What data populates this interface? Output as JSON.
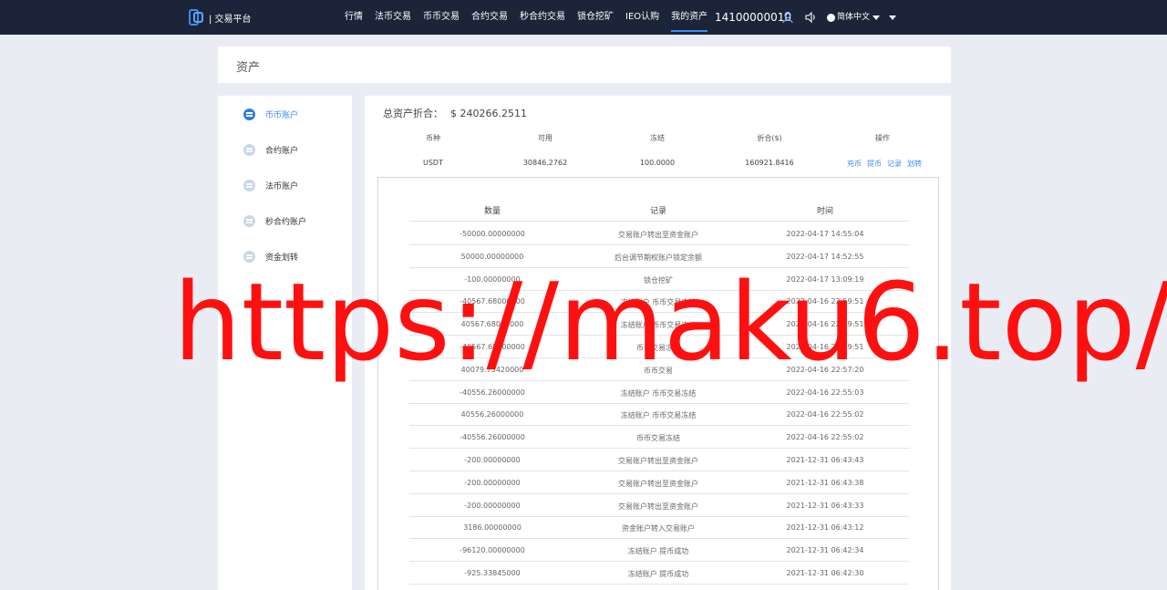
{
  "header": {
    "logo_text": "| 交易平台",
    "nav": [
      "行情",
      "法币交易",
      "币币交易",
      "合约交易",
      "秒合约交易",
      "锁仓挖矿",
      "IEO认购",
      "我的资产"
    ],
    "active_nav_index": 7,
    "phone": "14100000010",
    "language": "简体中文",
    "user_icon": "user-icon",
    "sound_icon": "speaker-icon",
    "accent_color": "#3b8cf5",
    "bar_color": "#1b2438"
  },
  "page_title": "资产",
  "sidebar": {
    "items": [
      {
        "label": "币币账户",
        "icon": "coin-account-icon"
      },
      {
        "label": "合约账户",
        "icon": "contract-account-icon"
      },
      {
        "label": "法币账户",
        "icon": "fiat-account-icon"
      },
      {
        "label": "秒合约账户",
        "icon": "second-contract-account-icon"
      },
      {
        "label": "资金划转",
        "icon": "transfer-icon"
      }
    ],
    "active_index": 0
  },
  "summary": {
    "label": "总资产折合：",
    "value": "$ 240266.2511"
  },
  "assets_table": {
    "headers": [
      "币种",
      "可用",
      "冻结",
      "折合($)",
      "操作"
    ],
    "row": {
      "currency": "USDT",
      "available": "30846.2762",
      "frozen": "100.0000",
      "converted": "160921.8416",
      "actions": [
        "充币",
        "提币",
        "记录",
        "划转"
      ]
    }
  },
  "records": {
    "headers": [
      "数量",
      "记录",
      "时间"
    ],
    "rows": [
      [
        "-50000.00000000",
        "交易账户转出至资金账户",
        "2022-04-17 14:55:04"
      ],
      [
        "50000.00000000",
        "后台调节期权账户锁定余额",
        "2022-04-17 14:52:55"
      ],
      [
        "-100.00000000",
        "锁仓挖矿",
        "2022-04-17 13:09:19"
      ],
      [
        "-40567.68000000",
        "冻结账户 币币交易冻结",
        "2022-04-16 22:59:51"
      ],
      [
        "40567.68000000",
        "冻结账户 币币交易冻结",
        "2022-04-16 22:59:51"
      ],
      [
        "-40567.68000000",
        "币币交易冻结",
        "2022-04-16 22:59:51"
      ],
      [
        "40079.73420000",
        "币币交易",
        "2022-04-16 22:57:20"
      ],
      [
        "-40556.26000000",
        "冻结账户 币币交易冻结",
        "2022-04-16 22:55:03"
      ],
      [
        "40556.26000000",
        "冻结账户 币币交易冻结",
        "2022-04-16 22:55:02"
      ],
      [
        "-40556.26000000",
        "币币交易冻结",
        "2022-04-16 22:55:02"
      ],
      [
        "-200.00000000",
        "交易账户转出至资金账户",
        "2021-12-31 06:43:43"
      ],
      [
        "-200.00000000",
        "交易账户转出至资金账户",
        "2021-12-31 06:43:38"
      ],
      [
        "-200.00000000",
        "交易账户转出至资金账户",
        "2021-12-31 06:43:33"
      ],
      [
        "3186.00000000",
        "资金账户转入交易账户",
        "2021-12-31 06:43:12"
      ],
      [
        "-96120.00000000",
        "冻结账户 提币成功",
        "2021-12-31 06:42:34"
      ],
      [
        "-925.33845000",
        "冻结账户 提币成功",
        "2021-12-31 06:42:30"
      ]
    ]
  },
  "watermark": "https://maku6.top/"
}
